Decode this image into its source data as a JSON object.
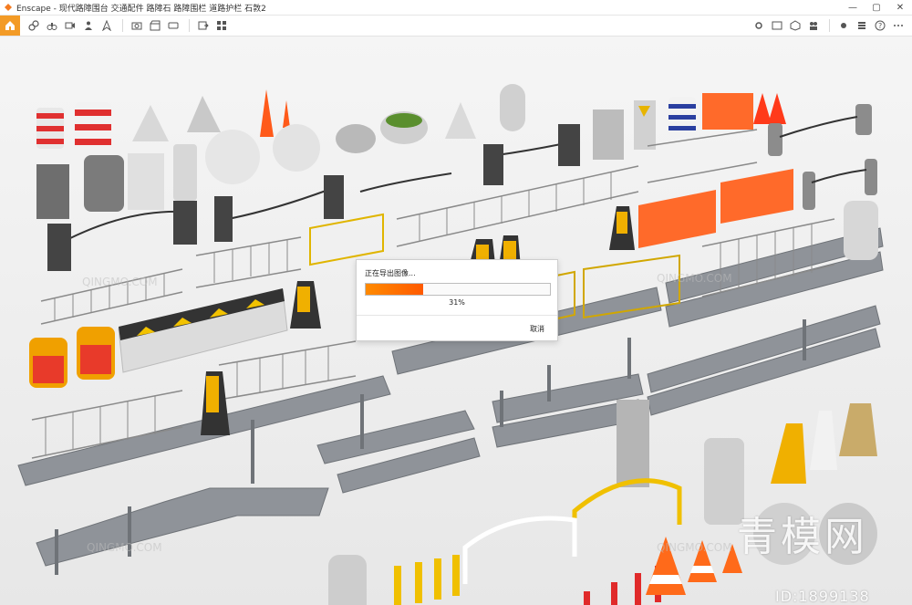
{
  "window": {
    "title": "Enscape - 现代路障围台 交通配件 路障石 路障围栏 道路护栏 石敦2",
    "controls": [
      "minimize-icon",
      "maximize-icon",
      "close-icon"
    ]
  },
  "toolbar": {
    "icons": [
      "home-icon",
      "link-icon",
      "binoculars-icon",
      "video-icon",
      "person-icon",
      "compass-icon",
      "capture-icon",
      "clapboard-icon",
      "panorama-icon",
      "export-icon",
      "asset-icon",
      "settings-icon",
      "view-icon",
      "collab-icon",
      "cube-icon",
      "sun-icon",
      "stack-icon",
      "help-icon",
      "more-icon"
    ]
  },
  "dialog": {
    "title": "正在导出图像...",
    "percent_text": "31%",
    "progress": 0.31,
    "cancel_label": "取消",
    "accent": "#ff6a00"
  },
  "watermark": {
    "text": "QINGMO.COM",
    "brand": "青模网",
    "id": "ID:1899138"
  }
}
